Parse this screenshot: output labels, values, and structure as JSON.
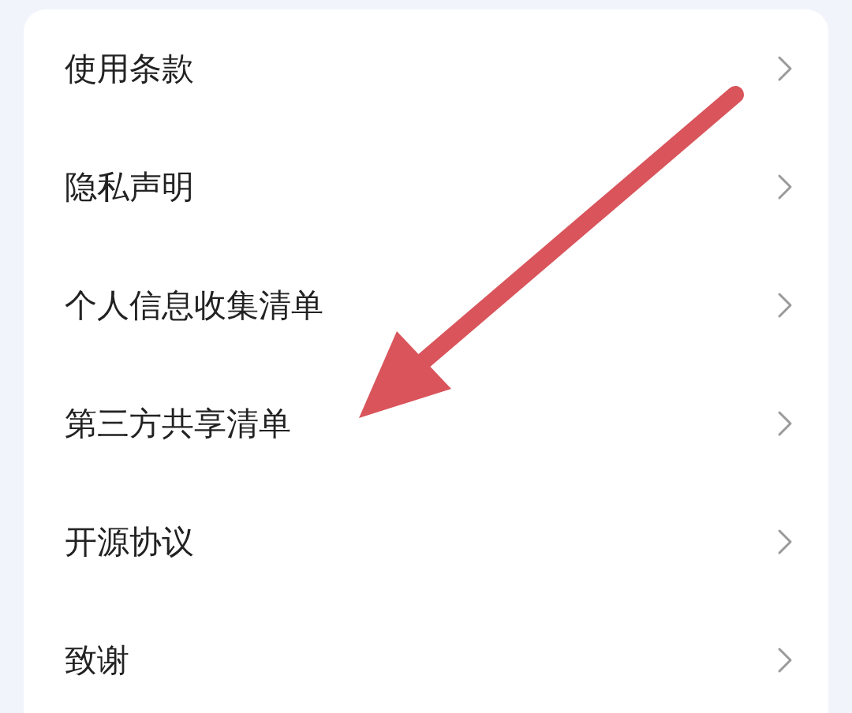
{
  "menu_items": [
    {
      "label": "使用条款"
    },
    {
      "label": "隐私声明"
    },
    {
      "label": "个人信息收集清单"
    },
    {
      "label": "第三方共享清单"
    },
    {
      "label": "开源协议"
    },
    {
      "label": "致谢"
    }
  ],
  "annotation": {
    "kind": "arrow"
  }
}
